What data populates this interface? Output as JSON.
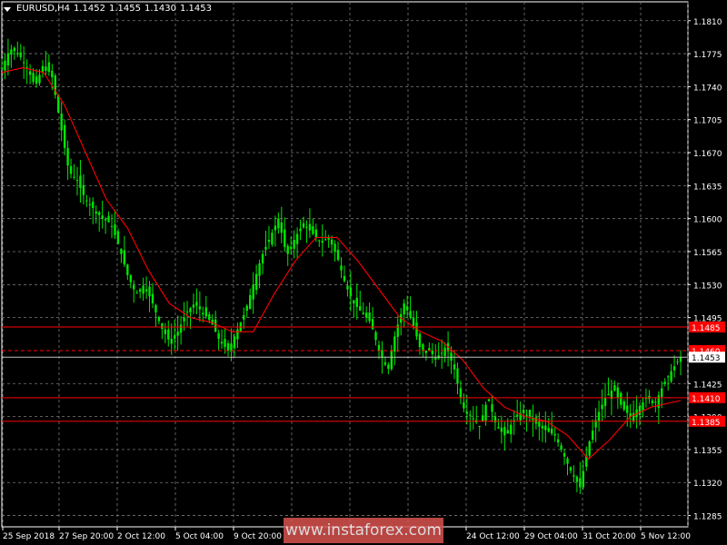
{
  "header": {
    "symbol": "EURUSD,H4",
    "open": "1.1452",
    "high": "1.1455",
    "low": "1.1430",
    "close": "1.1453"
  },
  "watermark": "www.instaforex.com",
  "colors": {
    "background": "#000000",
    "grid": "#7a7a7a",
    "candle": "#00e600",
    "ma": "#ff0000",
    "level": "#ff0000",
    "current_price_line": "#c0c0c0",
    "text": "#ffffff"
  },
  "chart_data": {
    "type": "candlestick",
    "y_ticks": [
      "1.1810",
      "1.1775",
      "1.1740",
      "1.1705",
      "1.1670",
      "1.1635",
      "1.1600",
      "1.1565",
      "1.1530",
      "1.1495",
      "1.1425",
      "1.1390",
      "1.1355",
      "1.1320",
      "1.1285"
    ],
    "x_ticks": [
      "25 Sep 2018",
      "27 Sep 20:00",
      "2 Oct 12:00",
      "5 Oct 04:00",
      "9 Oct 20:00",
      "",
      "",
      "24 Oct 12:00",
      "29 Oct 04:00",
      "31 Oct 20:00",
      "5 Nov 12:00"
    ],
    "ylim": [
      1.1273,
      1.183
    ],
    "grid": true,
    "levels": [
      {
        "label": "1.1485",
        "price": 1.1485,
        "style": "solid"
      },
      {
        "label": "1.1460",
        "price": 1.146,
        "style": "dashed"
      },
      {
        "label": "1.1410",
        "price": 1.141,
        "style": "solid"
      },
      {
        "label": "1.1385",
        "price": 1.1385,
        "style": "solid"
      }
    ],
    "current_price": {
      "label": "1.1453",
      "price": 1.1453
    },
    "close_path": [
      [
        0,
        1.176
      ],
      [
        4,
        1.178
      ],
      [
        8,
        1.1775
      ],
      [
        12,
        1.176
      ],
      [
        16,
        1.174
      ],
      [
        20,
        1.1765
      ],
      [
        24,
        1.175
      ],
      [
        28,
        1.17
      ],
      [
        32,
        1.165
      ],
      [
        36,
        1.164
      ],
      [
        40,
        1.162
      ],
      [
        44,
        1.161
      ],
      [
        48,
        1.16
      ],
      [
        52,
        1.1595
      ],
      [
        56,
        1.157
      ],
      [
        60,
        1.154
      ],
      [
        64,
        1.152
      ],
      [
        68,
        1.153
      ],
      [
        72,
        1.151
      ],
      [
        76,
        1.1485
      ],
      [
        80,
        1.147
      ],
      [
        84,
        1.148
      ],
      [
        88,
        1.15
      ],
      [
        92,
        1.151
      ],
      [
        96,
        1.15
      ],
      [
        100,
        1.149
      ],
      [
        104,
        1.147
      ],
      [
        108,
        1.146
      ],
      [
        112,
        1.148
      ],
      [
        116,
        1.15
      ],
      [
        120,
        1.153
      ],
      [
        124,
        1.156
      ],
      [
        128,
        1.158
      ],
      [
        132,
        1.16
      ],
      [
        136,
        1.156
      ],
      [
        140,
        1.158
      ],
      [
        144,
        1.1595
      ],
      [
        148,
        1.1585
      ],
      [
        152,
        1.1575
      ],
      [
        156,
        1.158
      ],
      [
        160,
        1.156
      ],
      [
        164,
        1.153
      ],
      [
        168,
        1.151
      ],
      [
        172,
        1.15
      ],
      [
        176,
        1.149
      ],
      [
        180,
        1.146
      ],
      [
        184,
        1.144
      ],
      [
        188,
        1.148
      ],
      [
        192,
        1.151
      ],
      [
        196,
        1.149
      ],
      [
        200,
        1.146
      ],
      [
        204,
        1.146
      ],
      [
        208,
        1.145
      ],
      [
        212,
        1.1465
      ],
      [
        216,
        1.144
      ],
      [
        220,
        1.14
      ],
      [
        224,
        1.139
      ],
      [
        228,
        1.138
      ],
      [
        232,
        1.141
      ],
      [
        236,
        1.138
      ],
      [
        240,
        1.137
      ],
      [
        244,
        1.1385
      ],
      [
        248,
        1.1395
      ],
      [
        252,
        1.139
      ],
      [
        256,
        1.138
      ],
      [
        260,
        1.1375
      ],
      [
        264,
        1.137
      ],
      [
        268,
        1.135
      ],
      [
        272,
        1.133
      ],
      [
        276,
        1.1315
      ],
      [
        280,
        1.136
      ],
      [
        284,
        1.139
      ],
      [
        288,
        1.141
      ],
      [
        292,
        1.142
      ],
      [
        296,
        1.14
      ],
      [
        300,
        1.139
      ],
      [
        304,
        1.14
      ],
      [
        308,
        1.141
      ],
      [
        312,
        1.1405
      ],
      [
        316,
        1.1425
      ],
      [
        320,
        1.144
      ],
      [
        324,
        1.1453
      ]
    ],
    "ma_path": [
      [
        0,
        1.1755
      ],
      [
        10,
        1.176
      ],
      [
        20,
        1.1755
      ],
      [
        30,
        1.172
      ],
      [
        40,
        1.167
      ],
      [
        50,
        1.162
      ],
      [
        60,
        1.159
      ],
      [
        70,
        1.1545
      ],
      [
        80,
        1.151
      ],
      [
        90,
        1.1495
      ],
      [
        100,
        1.149
      ],
      [
        110,
        1.148
      ],
      [
        120,
        1.148
      ],
      [
        130,
        1.152
      ],
      [
        140,
        1.1555
      ],
      [
        150,
        1.158
      ],
      [
        160,
        1.158
      ],
      [
        170,
        1.1555
      ],
      [
        180,
        1.1525
      ],
      [
        190,
        1.1495
      ],
      [
        200,
        1.148
      ],
      [
        210,
        1.147
      ],
      [
        220,
        1.145
      ],
      [
        230,
        1.142
      ],
      [
        240,
        1.14
      ],
      [
        250,
        1.139
      ],
      [
        260,
        1.1385
      ],
      [
        270,
        1.137
      ],
      [
        280,
        1.1345
      ],
      [
        290,
        1.1365
      ],
      [
        300,
        1.139
      ],
      [
        310,
        1.14
      ],
      [
        320,
        1.1405
      ],
      [
        324,
        1.1407
      ]
    ]
  }
}
